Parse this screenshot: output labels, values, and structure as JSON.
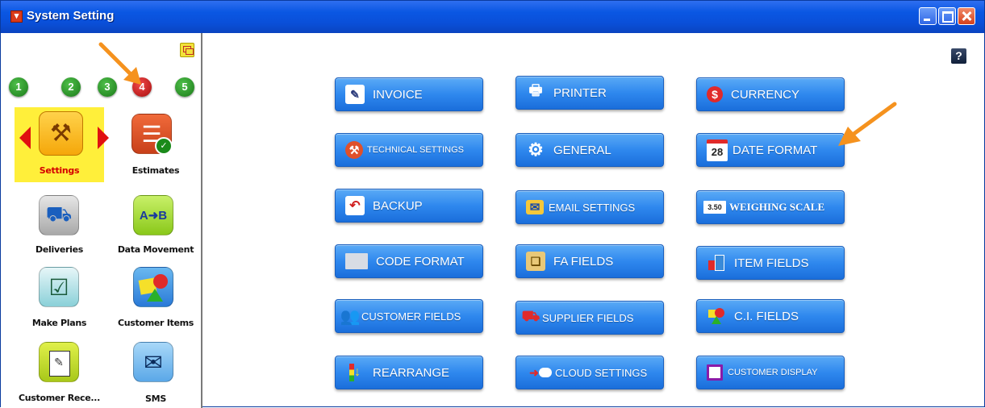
{
  "window": {
    "title": "System Setting",
    "controls": {
      "minimize": "minimize-icon",
      "maximize": "maximize-icon",
      "close": "close-icon"
    }
  },
  "sidebar": {
    "pages": [
      {
        "number": "1",
        "active": false
      },
      {
        "number": "2",
        "active": false
      },
      {
        "number": "3",
        "active": false
      },
      {
        "number": "4",
        "active": true
      },
      {
        "number": "5",
        "active": false
      }
    ],
    "items": [
      {
        "label": "Settings",
        "icon": "wrench-screwdriver-icon",
        "selected": true
      },
      {
        "label": "Estimates",
        "icon": "document-check-icon",
        "selected": false
      },
      {
        "label": "Deliveries",
        "icon": "delivery-truck-icon",
        "selected": false
      },
      {
        "label": "Data Movement",
        "icon": "a-to-b-icon",
        "selected": false
      },
      {
        "label": "Make Plans",
        "icon": "clipboard-check-icon",
        "selected": false
      },
      {
        "label": "Customer Items",
        "icon": "shapes-icon",
        "selected": false
      },
      {
        "label": "Customer Rece...",
        "icon": "receipt-icon",
        "selected": false
      },
      {
        "label": "SMS",
        "icon": "sms-phone-icon",
        "selected": false
      }
    ]
  },
  "content": {
    "help_label": "?",
    "buttons": [
      {
        "label": "INVOICE",
        "icon": "invoice-icon"
      },
      {
        "label": "PRINTER",
        "icon": "printer-icon"
      },
      {
        "label": "CURRENCY",
        "icon": "currency-icon"
      },
      {
        "label": "TECHNICAL SETTINGS",
        "icon": "technical-settings-icon"
      },
      {
        "label": "GENERAL",
        "icon": "gear-icon"
      },
      {
        "label": "DATE FORMAT",
        "icon": "calendar-icon",
        "icon_text": "28"
      },
      {
        "label": "BACKUP",
        "icon": "backup-arrow-icon"
      },
      {
        "label": "EMAIL SETTINGS",
        "icon": "email-icon"
      },
      {
        "label": "WEIGHING SCALE",
        "icon": "scale-icon",
        "icon_text": "3.50"
      },
      {
        "label": "CODE FORMAT",
        "icon": "code-format-icon"
      },
      {
        "label": "FA FIELDS",
        "icon": "fa-fields-icon"
      },
      {
        "label": "ITEM FIELDS",
        "icon": "item-fields-icon"
      },
      {
        "label": "CUSTOMER FIELDS",
        "icon": "customer-fields-icon"
      },
      {
        "label": "SUPPLIER FIELDS",
        "icon": "supplier-truck-icon"
      },
      {
        "label": "C.I. FIELDS",
        "icon": "ci-fields-icon"
      },
      {
        "label": "REARRANGE",
        "icon": "rearrange-icon"
      },
      {
        "label": "CLOUD SETTINGS",
        "icon": "cloud-icon"
      },
      {
        "label": "CUSTOMER DISPLAY",
        "icon": "display-icon"
      }
    ]
  },
  "colors": {
    "titlebar": "#0a57e3",
    "button": "#2f88ee",
    "selected_highlight": "#ffef3a",
    "annotation_arrow": "#f5921e"
  }
}
